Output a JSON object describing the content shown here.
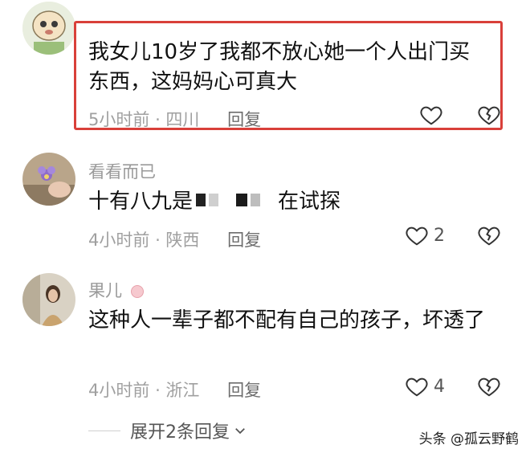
{
  "comments": [
    {
      "username": "",
      "text": "我女儿10岁了我都不放心她一个人出门买东西，这妈妈心可真大",
      "time": "5小时前",
      "location": "四川",
      "reply_label": "回复",
      "likes": ""
    },
    {
      "username": "看看而已",
      "text_prefix": "十有八九是",
      "text_suffix": "在试探",
      "time": "4小时前",
      "location": "陕西",
      "reply_label": "回复",
      "likes": "2"
    },
    {
      "username": "果儿",
      "text": "这种人一辈子都不配有自己的孩子，坏透了",
      "time": "4小时前",
      "location": "浙江",
      "reply_label": "回复",
      "likes": "4"
    }
  ],
  "expand_replies": "展开2条回复",
  "watermark": "头条 @孤云野鹤",
  "colors": {
    "highlight": "#d9403a",
    "meta": "#a0a0a0"
  },
  "icons": [
    "like-heart-icon",
    "dislike-broken-heart-icon",
    "chevron-down-icon"
  ]
}
